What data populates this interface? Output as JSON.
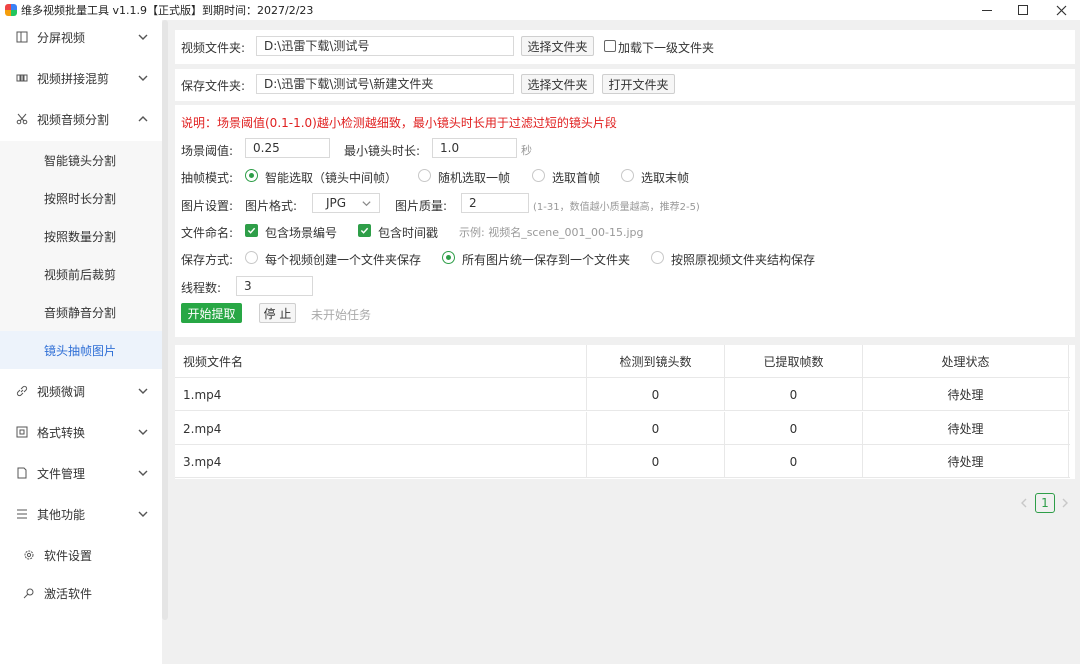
{
  "window": {
    "title": "维多视频批量工具 v1.1.9【正式版】到期时间：2027/2/23"
  },
  "sidebar": {
    "groups": [
      {
        "label": "分屏视频",
        "icon": "split-screen-icon"
      },
      {
        "label": "视频拼接混剪",
        "icon": "video-merge-icon"
      },
      {
        "label": "视频音频分割",
        "icon": "scissors-icon"
      }
    ],
    "sub_items": [
      {
        "label": "智能镜头分割"
      },
      {
        "label": "按照时长分割"
      },
      {
        "label": "按照数量分割"
      },
      {
        "label": "视频前后裁剪"
      },
      {
        "label": "音频静音分割"
      },
      {
        "label": "镜头抽帧图片"
      }
    ],
    "lower_groups": [
      {
        "label": "视频微调",
        "icon": "link-icon"
      },
      {
        "label": "格式转换",
        "icon": "convert-icon"
      },
      {
        "label": "文件管理",
        "icon": "file-icon"
      },
      {
        "label": "其他功能",
        "icon": "menu-icon"
      }
    ],
    "plain_items": [
      {
        "label": "软件设置",
        "icon": "gear-icon"
      },
      {
        "label": "激活软件",
        "icon": "key-icon"
      }
    ]
  },
  "video_folder": {
    "label": "视频文件夹:",
    "value": "D:\\迅雷下载\\测试号",
    "browse_label": "选择文件夹",
    "subfolder_label": "加载下一级文件夹",
    "subfolder_checked": false
  },
  "save_folder": {
    "label": "保存文件夹:",
    "value": "D:\\迅雷下载\\测试号\\新建文件夹",
    "browse_label": "选择文件夹",
    "open_label": "打开文件夹"
  },
  "settings": {
    "note": "说明：场景阈值(0.1-1.0)越小检测越细致，最小镜头时长用于过滤过短的镜头片段",
    "threshold_label": "场景阈值:",
    "threshold_value": "0.25",
    "min_duration_label": "最小镜头时长:",
    "min_duration_value": "1.0",
    "min_duration_unit": "秒",
    "frame_mode_label": "抽帧模式:",
    "frame_modes": [
      {
        "label": "智能选取（镜头中间帧）",
        "selected": true
      },
      {
        "label": "随机选取一帧",
        "selected": false
      },
      {
        "label": "选取首帧",
        "selected": false
      },
      {
        "label": "选取末帧",
        "selected": false
      }
    ],
    "image_settings_label": "图片设置:",
    "image_format_label": "图片格式:",
    "image_format_value": "JPG",
    "image_quality_label": "图片质量:",
    "image_quality_value": "2",
    "image_quality_hint": "(1-31，数值越小质量越高，推荐2-5)",
    "naming_label": "文件命名:",
    "naming_options": [
      {
        "label": "包含场景编号",
        "checked": true
      },
      {
        "label": "包含时间戳",
        "checked": true
      }
    ],
    "naming_example": "示例: 视频名_scene_001_00-15.jpg",
    "save_mode_label": "保存方式:",
    "save_modes": [
      {
        "label": "每个视频创建一个文件夹保存",
        "selected": false
      },
      {
        "label": "所有图片统一保存到一个文件夹",
        "selected": true
      },
      {
        "label": "按照原视频文件夹结构保存",
        "selected": false
      }
    ],
    "threads_label": "线程数:",
    "threads_value": "3",
    "start_label": "开始提取",
    "stop_label": "停 止",
    "status_text": "未开始任务"
  },
  "table": {
    "columns": [
      "视频文件名",
      "检测到镜头数",
      "已提取帧数",
      "处理状态"
    ],
    "rows": [
      [
        "1.mp4",
        "0",
        "0",
        "待处理"
      ],
      [
        "2.mp4",
        "0",
        "0",
        "待处理"
      ],
      [
        "3.mp4",
        "0",
        "0",
        "待处理"
      ]
    ]
  },
  "pagination": {
    "current_page": "1"
  },
  "colors": {
    "accent_green": "#28a745",
    "note_red": "#e02020",
    "selected_blue": "#2f6fd6"
  }
}
